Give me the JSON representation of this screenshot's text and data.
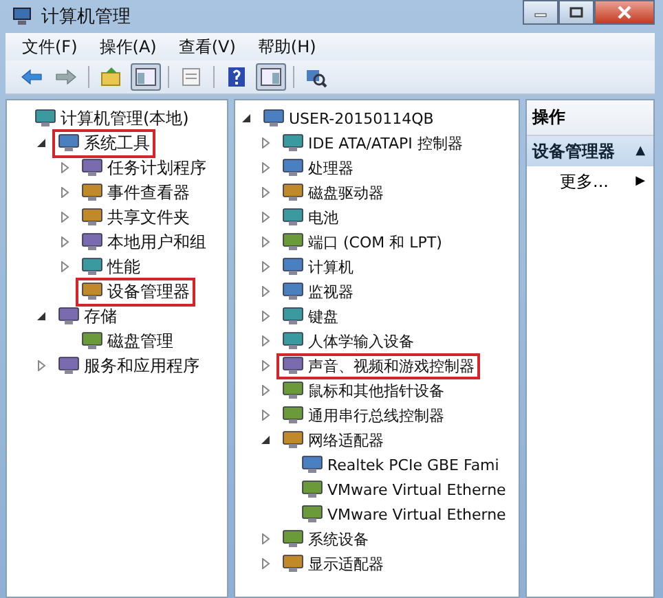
{
  "window": {
    "title": "计算机管理"
  },
  "menu": [
    "文件(F)",
    "操作(A)",
    "查看(V)",
    "帮助(H)"
  ],
  "toolbar": [
    {
      "kind": "back",
      "pressed": false
    },
    {
      "kind": "forward",
      "pressed": false
    },
    {
      "kind": "up",
      "pressed": false,
      "separator_before": true
    },
    {
      "kind": "tree",
      "pressed": true
    },
    {
      "kind": "props",
      "pressed": false,
      "separator_before": true
    },
    {
      "kind": "help",
      "pressed": false,
      "separator_before": true
    },
    {
      "kind": "actionpane",
      "pressed": true
    },
    {
      "kind": "scan",
      "pressed": false,
      "separator_before": true
    }
  ],
  "left_tree": [
    {
      "label": "计算机管理(本地)",
      "children": [
        {
          "label": "系统工具",
          "expanded": true,
          "highlighted": true,
          "children": [
            {
              "label": "任务计划程序",
              "expanded": false
            },
            {
              "label": "事件查看器",
              "expanded": false
            },
            {
              "label": "共享文件夹",
              "expanded": false
            },
            {
              "label": "本地用户和组",
              "expanded": false
            },
            {
              "label": "性能",
              "expanded": false
            },
            {
              "label": "设备管理器",
              "highlighted": true
            }
          ]
        },
        {
          "label": "存储",
          "expanded": true,
          "children": [
            {
              "label": "磁盘管理"
            }
          ]
        },
        {
          "label": "服务和应用程序",
          "expanded": false
        }
      ]
    }
  ],
  "device_tree": [
    {
      "label": "USER-20150114QB",
      "expanded": true,
      "children": [
        {
          "label": "IDE ATA/ATAPI 控制器",
          "expanded": false
        },
        {
          "label": "处理器",
          "expanded": false
        },
        {
          "label": "磁盘驱动器",
          "expanded": false
        },
        {
          "label": "电池",
          "expanded": false
        },
        {
          "label": "端口 (COM 和 LPT)",
          "expanded": false
        },
        {
          "label": "计算机",
          "expanded": false
        },
        {
          "label": "监视器",
          "expanded": false
        },
        {
          "label": "键盘",
          "expanded": false
        },
        {
          "label": "人体学输入设备",
          "expanded": false
        },
        {
          "label": "声音、视频和游戏控制器",
          "expanded": false,
          "highlighted": true
        },
        {
          "label": "鼠标和其他指针设备",
          "expanded": false
        },
        {
          "label": "通用串行总线控制器",
          "expanded": false
        },
        {
          "label": "网络适配器",
          "expanded": true,
          "children": [
            {
              "label": "Realtek PCIe GBE Fami"
            },
            {
              "label": "VMware Virtual Etherne"
            },
            {
              "label": "VMware Virtual Etherne"
            }
          ]
        },
        {
          "label": "系统设备",
          "expanded": false
        },
        {
          "label": "显示适配器",
          "expanded": false
        }
      ]
    }
  ],
  "actions": {
    "title": "操作",
    "items": [
      {
        "kind": "section",
        "label": "设备管理器",
        "arrow": "▲"
      },
      {
        "kind": "link",
        "label": "更多...",
        "arrow": "▶"
      }
    ]
  }
}
